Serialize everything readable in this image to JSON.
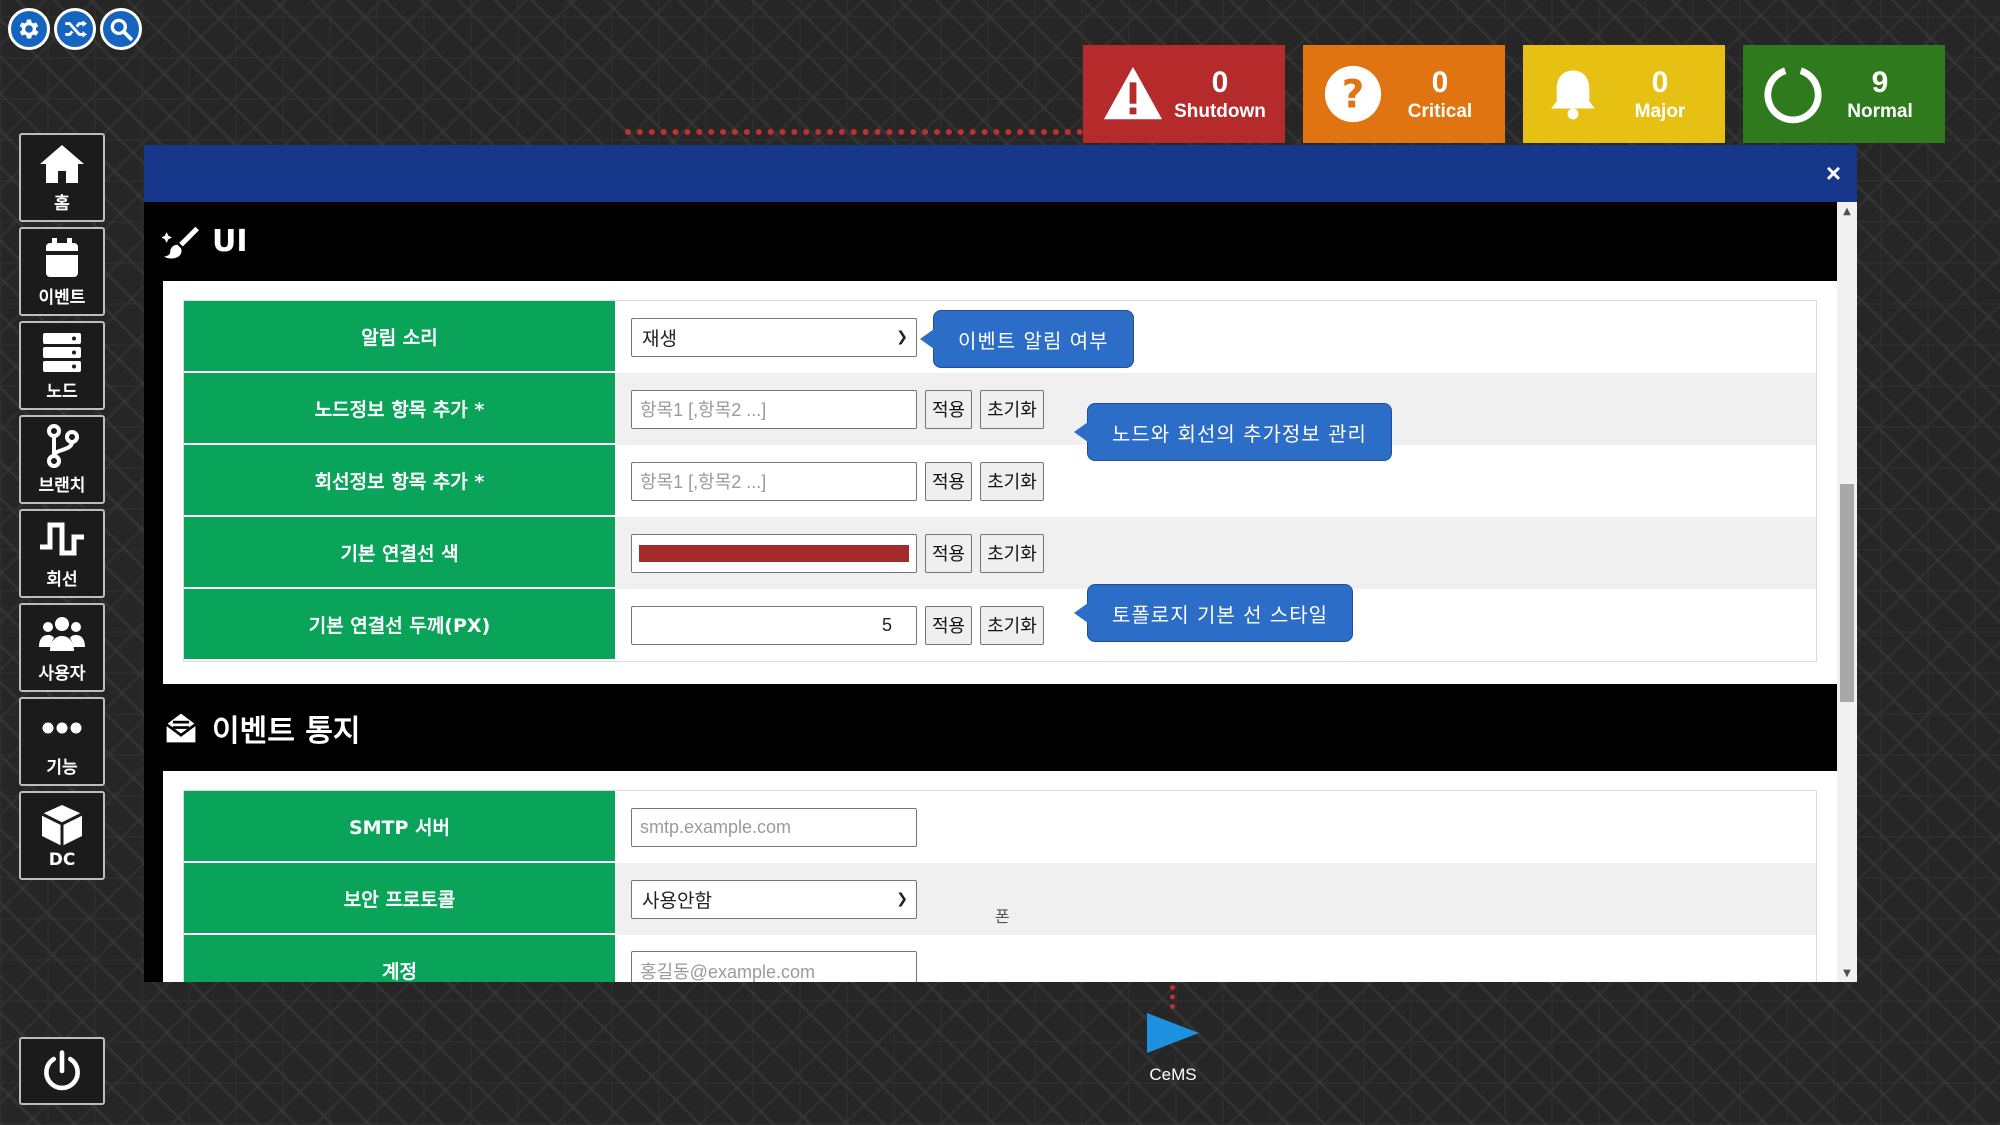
{
  "top_tools": [
    {
      "name": "settings",
      "icon": "gear-icon"
    },
    {
      "name": "shuffle",
      "icon": "shuffle-icon"
    },
    {
      "name": "search",
      "icon": "search-icon"
    }
  ],
  "status": {
    "shutdown": {
      "count": "0",
      "label": "Shutdown",
      "color": "#b52a2a"
    },
    "critical": {
      "count": "0",
      "label": "Critical",
      "color": "#e07411"
    },
    "major": {
      "count": "0",
      "label": "Major",
      "color": "#e6c012"
    },
    "normal": {
      "count": "9",
      "label": "Normal",
      "color": "#2f7a1d"
    }
  },
  "sidebar": {
    "items": [
      {
        "label": "홈",
        "icon": "home-icon"
      },
      {
        "label": "이벤트",
        "icon": "calendar-icon"
      },
      {
        "label": "노드",
        "icon": "server-icon"
      },
      {
        "label": "브랜치",
        "icon": "branch-icon"
      },
      {
        "label": "회선",
        "icon": "signal-line-icon"
      },
      {
        "label": "사용자",
        "icon": "users-icon"
      },
      {
        "label": "기능",
        "icon": "more-icon"
      },
      {
        "label": "DC",
        "icon": "cube-icon"
      }
    ],
    "power_icon": "power-icon"
  },
  "modal": {
    "close_label": "×",
    "ui_section": {
      "title": "UI",
      "rows": [
        {
          "label": "알림 소리",
          "select_value": "재생"
        },
        {
          "label": "노드정보 항목 추가 *",
          "placeholder": "항목1 [,항목2 ...]"
        },
        {
          "label": "회선정보 항목 추가 *",
          "placeholder": "항목1 [,항목2 ...]"
        },
        {
          "label": "기본 연결선 색",
          "color": "#a52a2a"
        },
        {
          "label": "기본 연결선 두께(PX)",
          "value": "5"
        }
      ],
      "apply_label": "적용",
      "reset_label": "초기화",
      "tooltips": {
        "sound": "이벤트 알림 여부",
        "extra_info": "노드와 회선의 추가정보 관리",
        "line_style": "토폴로지 기본 선 스타일"
      }
    },
    "event_section": {
      "title": "이벤트 통지",
      "rows": [
        {
          "label": "SMTP 서버",
          "placeholder": "smtp.example.com"
        },
        {
          "label": "보안 프로토콜",
          "select_value": "사용안함"
        },
        {
          "label": "계정",
          "placeholder": "홍길동@example.com"
        }
      ]
    },
    "ghost_text": "폰"
  },
  "cems": {
    "label": "CeMS"
  }
}
